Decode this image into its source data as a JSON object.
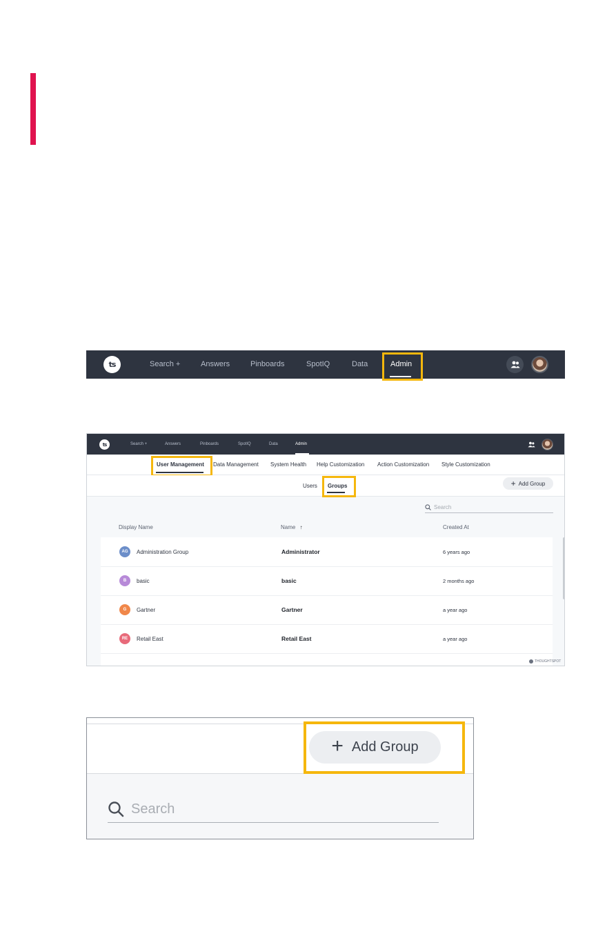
{
  "logo_text": "ts",
  "nav": {
    "items": [
      "Search +",
      "Answers",
      "Pinboards",
      "SpotIQ",
      "Data"
    ],
    "active": "Admin"
  },
  "admin_tabs": {
    "items": [
      "Data Management",
      "System Health",
      "Help Customization",
      "Action Customization",
      "Style Customization"
    ],
    "active": "User Management"
  },
  "group_tabs": {
    "users": "Users",
    "groups": "Groups"
  },
  "add_group_label": "Add Group",
  "search_placeholder": "Search",
  "table": {
    "columns": {
      "display_name": "Display Name",
      "name": "Name",
      "sort_indicator": "↑",
      "created_at": "Created At"
    },
    "rows": [
      {
        "initials": "AG",
        "display_name": "Administration Group",
        "name": "Administrator",
        "created_at": "6 years ago",
        "color": "#6c8ec9"
      },
      {
        "initials": "B",
        "display_name": "basic",
        "name": "basic",
        "created_at": "2 months ago",
        "color": "#b78ad8"
      },
      {
        "initials": "G",
        "display_name": "Gartner",
        "name": "Gartner",
        "created_at": "a year ago",
        "color": "#f0874a"
      },
      {
        "initials": "RE",
        "display_name": "Retail East",
        "name": "Retail East",
        "created_at": "a year ago",
        "color": "#e86a7a"
      }
    ]
  },
  "watermark": "THOUGHTSPOT",
  "colors": {
    "accent_bar": "#e0134f",
    "highlight": "#f5b70d",
    "nav_bg": "#2e3440"
  }
}
